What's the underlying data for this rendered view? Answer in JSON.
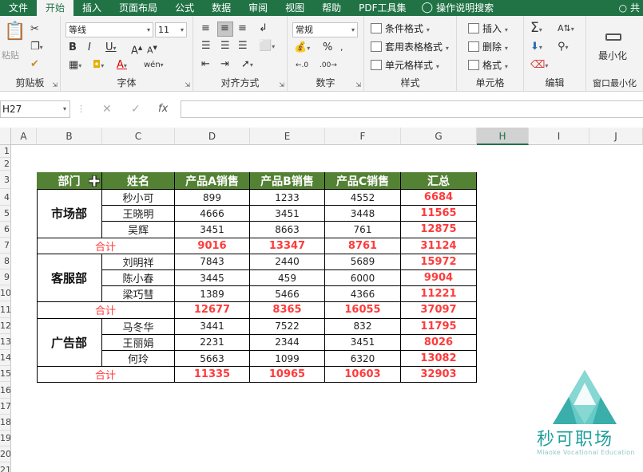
{
  "tabs": [
    "文件",
    "开始",
    "插入",
    "页面布局",
    "公式",
    "数据",
    "审阅",
    "视图",
    "帮助",
    "PDF工具集",
    "操作说明搜索"
  ],
  "active_tab": "开始",
  "user_glyph": "共",
  "groups": {
    "clipboard": {
      "label": "剪贴板",
      "paste": "粘贴"
    },
    "font": {
      "label": "字体",
      "font_name": "等线",
      "font_size": "11"
    },
    "alignment": {
      "label": "对齐方式"
    },
    "number": {
      "label": "数字",
      "format": "常规"
    },
    "styles": {
      "label": "样式",
      "conditional": "条件格式",
      "table": "套用表格格式",
      "cell": "单元格样式"
    },
    "cells": {
      "label": "单元格",
      "insert": "插入",
      "delete": "删除",
      "format": "格式"
    },
    "editing": {
      "label": "编辑"
    },
    "window": {
      "label": "窗口最小化",
      "minimize": "最小化"
    }
  },
  "formula_bar": {
    "name_box": "H27",
    "fx": "fx",
    "value": ""
  },
  "columns": [
    "A",
    "B",
    "C",
    "D",
    "E",
    "F",
    "G",
    "H",
    "I",
    "J"
  ],
  "selected_column": "H",
  "rows": [
    "1",
    "2",
    "3",
    "4",
    "5",
    "6",
    "7",
    "8",
    "9",
    "10",
    "11",
    "12",
    "13",
    "14",
    "15",
    "16",
    "17",
    "18",
    "19",
    "20",
    "21"
  ],
  "table": {
    "headers": [
      "部门",
      "姓名",
      "产品A销售",
      "产品B销售",
      "产品C销售",
      "汇总"
    ],
    "groups": [
      {
        "dept": "市场部",
        "rows": [
          {
            "name": "秒小可",
            "a": "899",
            "b": "1233",
            "c": "4552",
            "sum": "6684"
          },
          {
            "name": "王晓明",
            "a": "4666",
            "b": "3451",
            "c": "3448",
            "sum": "11565"
          },
          {
            "name": "吴辉",
            "a": "3451",
            "b": "8663",
            "c": "761",
            "sum": "12875"
          }
        ],
        "total": {
          "label": "合计",
          "a": "9016",
          "b": "13347",
          "c": "8761",
          "sum": "31124"
        }
      },
      {
        "dept": "客服部",
        "rows": [
          {
            "name": "刘明祥",
            "a": "7843",
            "b": "2440",
            "c": "5689",
            "sum": "15972"
          },
          {
            "name": "陈小春",
            "a": "3445",
            "b": "459",
            "c": "6000",
            "sum": "9904"
          },
          {
            "name": "梁巧彗",
            "a": "1389",
            "b": "5466",
            "c": "4366",
            "sum": "11221"
          }
        ],
        "total": {
          "label": "合计",
          "a": "12677",
          "b": "8365",
          "c": "16055",
          "sum": "37097"
        }
      },
      {
        "dept": "广告部",
        "rows": [
          {
            "name": "马冬华",
            "a": "3441",
            "b": "7522",
            "c": "832",
            "sum": "11795"
          },
          {
            "name": "王丽娟",
            "a": "2231",
            "b": "2344",
            "c": "3451",
            "sum": "8026"
          },
          {
            "name": "何玲",
            "a": "5663",
            "b": "1099",
            "c": "6320",
            "sum": "13082"
          }
        ],
        "total": {
          "label": "合计",
          "a": "11335",
          "b": "10965",
          "c": "10603",
          "sum": "32903"
        }
      }
    ]
  },
  "watermark": {
    "title": "秒可职场",
    "subtitle": "Miaoke Vocational Education"
  },
  "colors": {
    "ribbon_green": "#217346",
    "header_green": "#548235",
    "sum_red": "#ff3b3b",
    "watermark_teal": "#1d9e9a"
  }
}
